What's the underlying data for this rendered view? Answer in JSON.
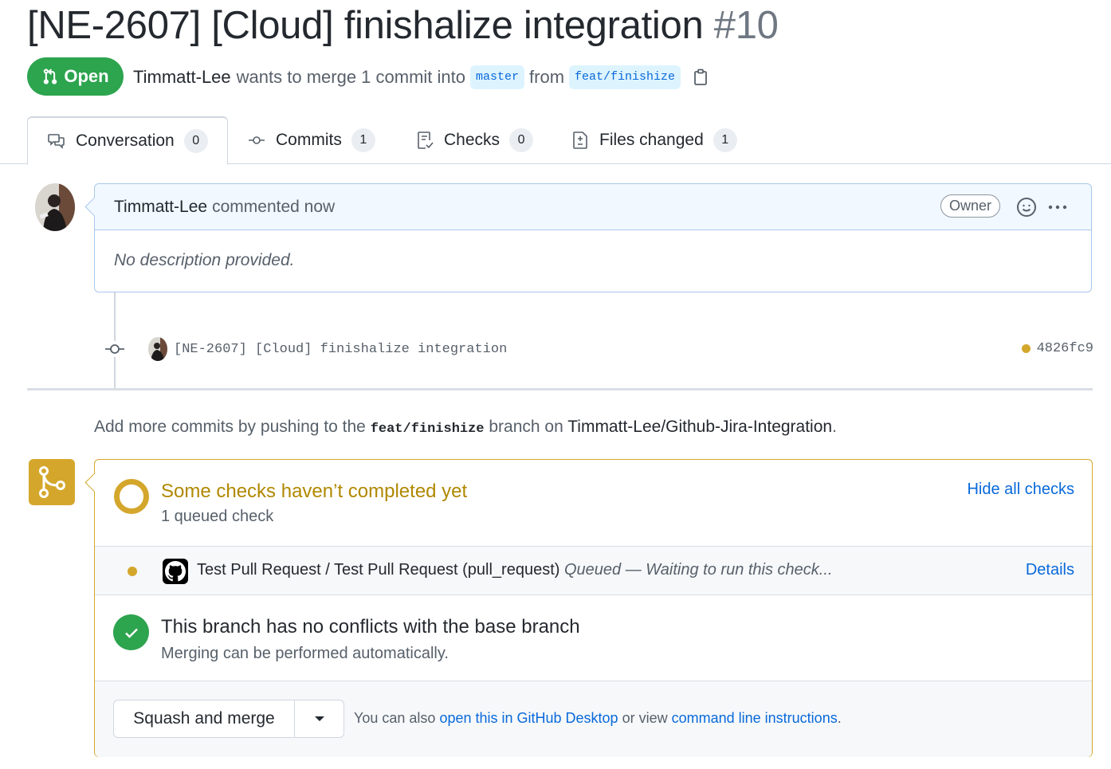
{
  "pr": {
    "title": "[NE-2607] [Cloud] finishalize integration",
    "number": "#10",
    "state": "Open",
    "author": "Timmatt-Lee",
    "merge_text_1": "wants to merge 1 commit into",
    "base_branch": "master",
    "merge_text_2": "from",
    "head_branch": "feat/finishize"
  },
  "tabs": [
    {
      "label": "Conversation",
      "count": "0",
      "icon": "comment-discussion-icon"
    },
    {
      "label": "Commits",
      "count": "1",
      "icon": "git-commit-icon"
    },
    {
      "label": "Checks",
      "count": "0",
      "icon": "checklist-icon"
    },
    {
      "label": "Files changed",
      "count": "1",
      "icon": "file-diff-icon"
    }
  ],
  "comment": {
    "author": "Timmatt-Lee",
    "action": "commented now",
    "role_badge": "Owner",
    "body": "No description provided."
  },
  "commit": {
    "message": "[NE-2607] [Cloud] finishalize integration",
    "sha": "4826fc9",
    "status_color": "#d4a72c"
  },
  "push_hint": {
    "prefix": "Add more commits by pushing to the",
    "branch": "feat/finishize",
    "middle": "branch on",
    "repo": "Timmatt-Lee/Github-Jira-Integration",
    "suffix": "."
  },
  "checks": {
    "title": "Some checks haven’t completed yet",
    "subtitle": "1 queued check",
    "toggle_label": "Hide all checks",
    "items": [
      {
        "name": "Test Pull Request / Test Pull Request (pull_request)",
        "status": "Queued — Waiting to run this check...",
        "link": "Details"
      }
    ]
  },
  "conflicts": {
    "title": "This branch has no conflicts with the base branch",
    "subtitle": "Merging can be performed automatically."
  },
  "merge": {
    "button_label": "Squash and merge",
    "hint_prefix": "You can also",
    "desktop_link": "open this in GitHub Desktop",
    "hint_middle": "or view",
    "cli_link": "command line instructions",
    "hint_suffix": "."
  },
  "colors": {
    "open_green": "#2da44e",
    "pending_yellow": "#d4a72c",
    "link_blue": "#0969da"
  }
}
